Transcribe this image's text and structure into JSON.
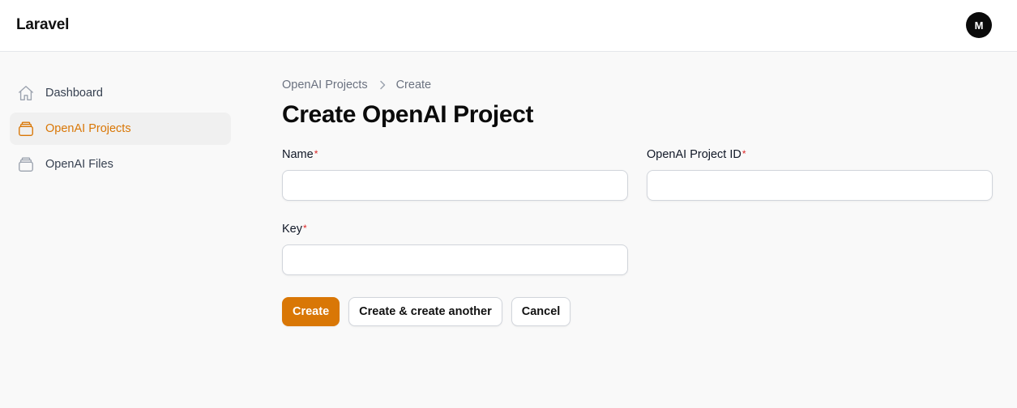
{
  "app": {
    "brand": "Laravel",
    "avatar_initial": "M"
  },
  "sidebar": {
    "items": [
      {
        "label": "Dashboard",
        "icon": "home-icon",
        "active": false
      },
      {
        "label": "OpenAI Projects",
        "icon": "stack-icon",
        "active": true
      },
      {
        "label": "OpenAI Files",
        "icon": "stack-icon",
        "active": false
      }
    ]
  },
  "breadcrumb": {
    "parent": "OpenAI Projects",
    "current": "Create"
  },
  "page": {
    "title": "Create OpenAI Project"
  },
  "form": {
    "required_marker": "*",
    "name": {
      "label": "Name",
      "value": "",
      "placeholder": ""
    },
    "project_id": {
      "label": "OpenAI Project ID",
      "value": "",
      "placeholder": ""
    },
    "key": {
      "label": "Key",
      "value": "",
      "placeholder": ""
    }
  },
  "actions": {
    "create": "Create",
    "create_another": "Create & create another",
    "cancel": "Cancel"
  },
  "colors": {
    "accent": "#d97706",
    "required": "#dc2626"
  }
}
